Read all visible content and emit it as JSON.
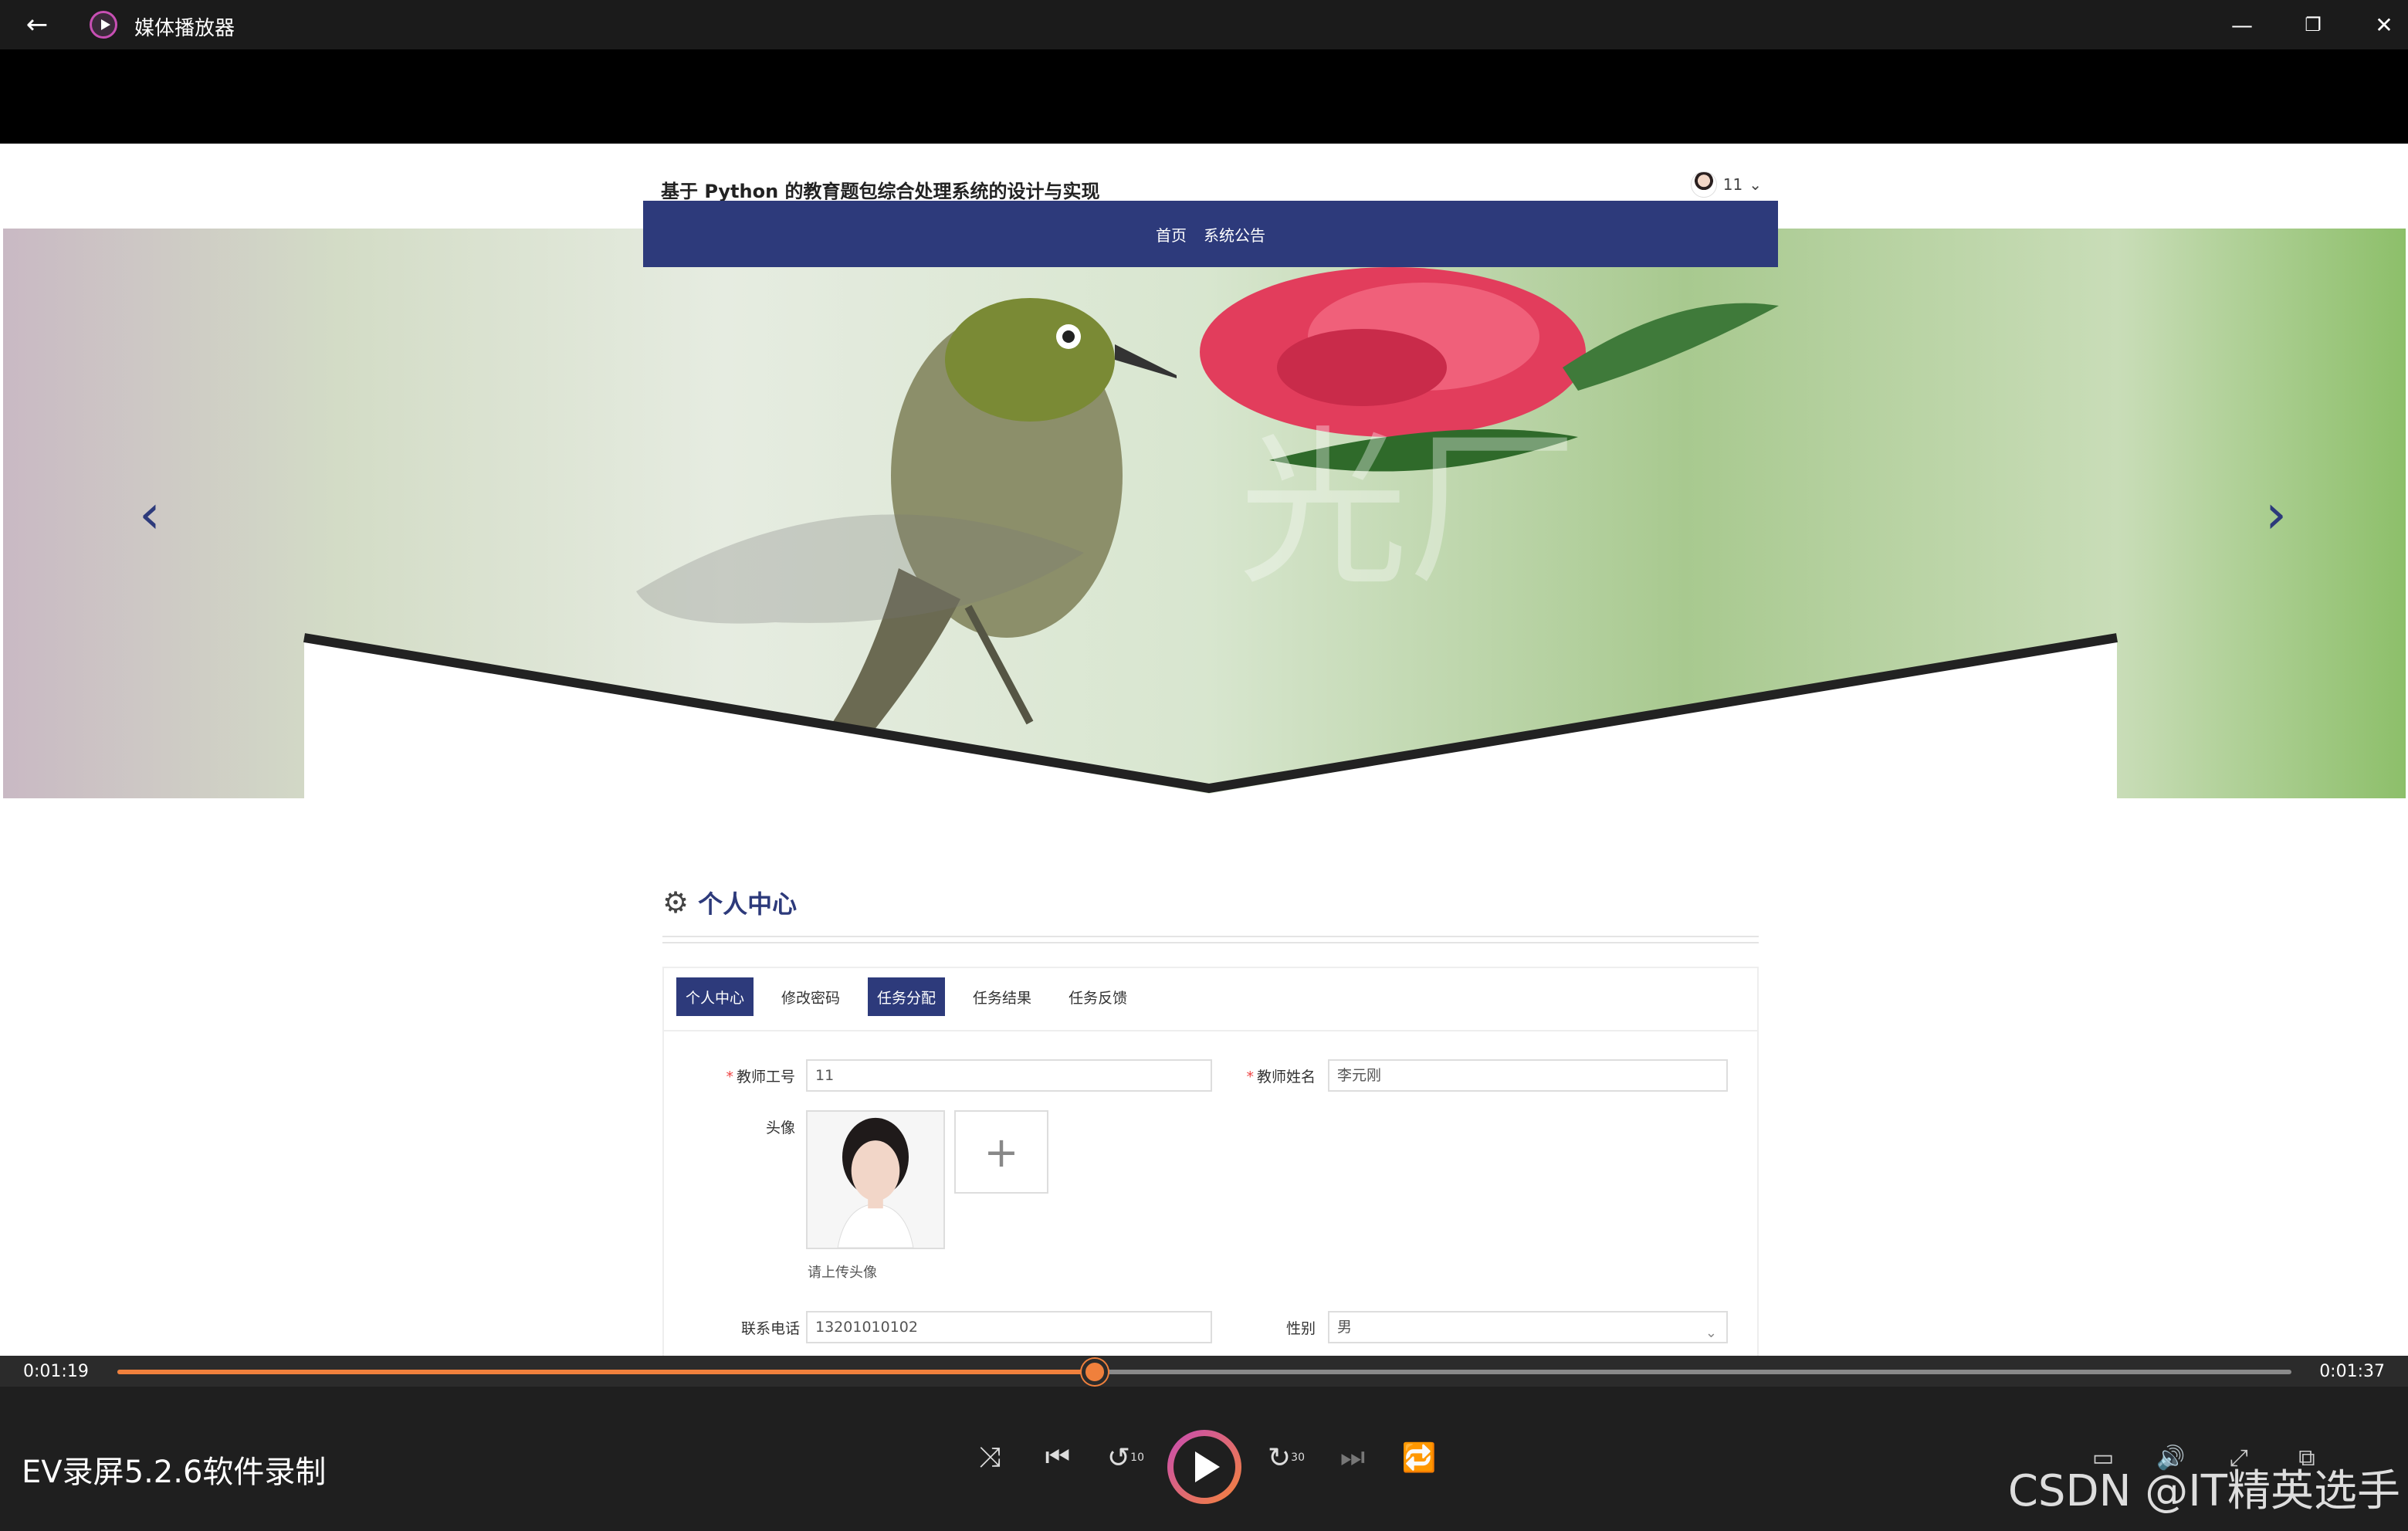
{
  "window": {
    "app_title": "媒体播放器",
    "icons": {
      "back": "←",
      "minimize": "—",
      "restore": "❐",
      "close": "✕"
    }
  },
  "site": {
    "title": "基于 Python 的教育题包综合处理系统的设计与实现",
    "user_name": "11",
    "user_chevron": "⌄",
    "nav": [
      "首页",
      "系统公告"
    ],
    "banner_prev": "‹",
    "banner_next": "›"
  },
  "profile": {
    "section_title": "个人中心",
    "section_icon": "⚙",
    "tabs": [
      {
        "label": "个人中心",
        "active": true
      },
      {
        "label": "修改密码",
        "active": false
      },
      {
        "label": "任务分配",
        "active": true
      },
      {
        "label": "任务结果",
        "active": false
      },
      {
        "label": "任务反馈",
        "active": false
      }
    ],
    "fields": {
      "teacher_id_label": "教师工号",
      "teacher_id_value": "11",
      "teacher_name_label": "教师姓名",
      "teacher_name_value": "李元刚",
      "avatar_label": "头像",
      "upload_plus": "+",
      "avatar_hint": "请上传头像",
      "phone_label": "联系电话",
      "phone_value": "13201010102",
      "gender_label": "性别",
      "gender_value": "男"
    }
  },
  "player": {
    "current_time": "0:01:19",
    "total_time": "0:01:37",
    "progress": 0.4497,
    "media_title": "EV录屏5.2.6软件录制",
    "icons": {
      "shuffle": "⤨",
      "previous": "⏮",
      "rewind": "↺",
      "rewind_label": "10",
      "forward": "↻",
      "forward_label": "30",
      "next": "⏭",
      "repeat": "🔁",
      "subtitles": "▭",
      "volume": "🔊",
      "fullscreen": "⤢",
      "miniplayer": "⧉"
    },
    "watermark": "CSDN @IT精英选手",
    "accent": "#f0803c"
  }
}
